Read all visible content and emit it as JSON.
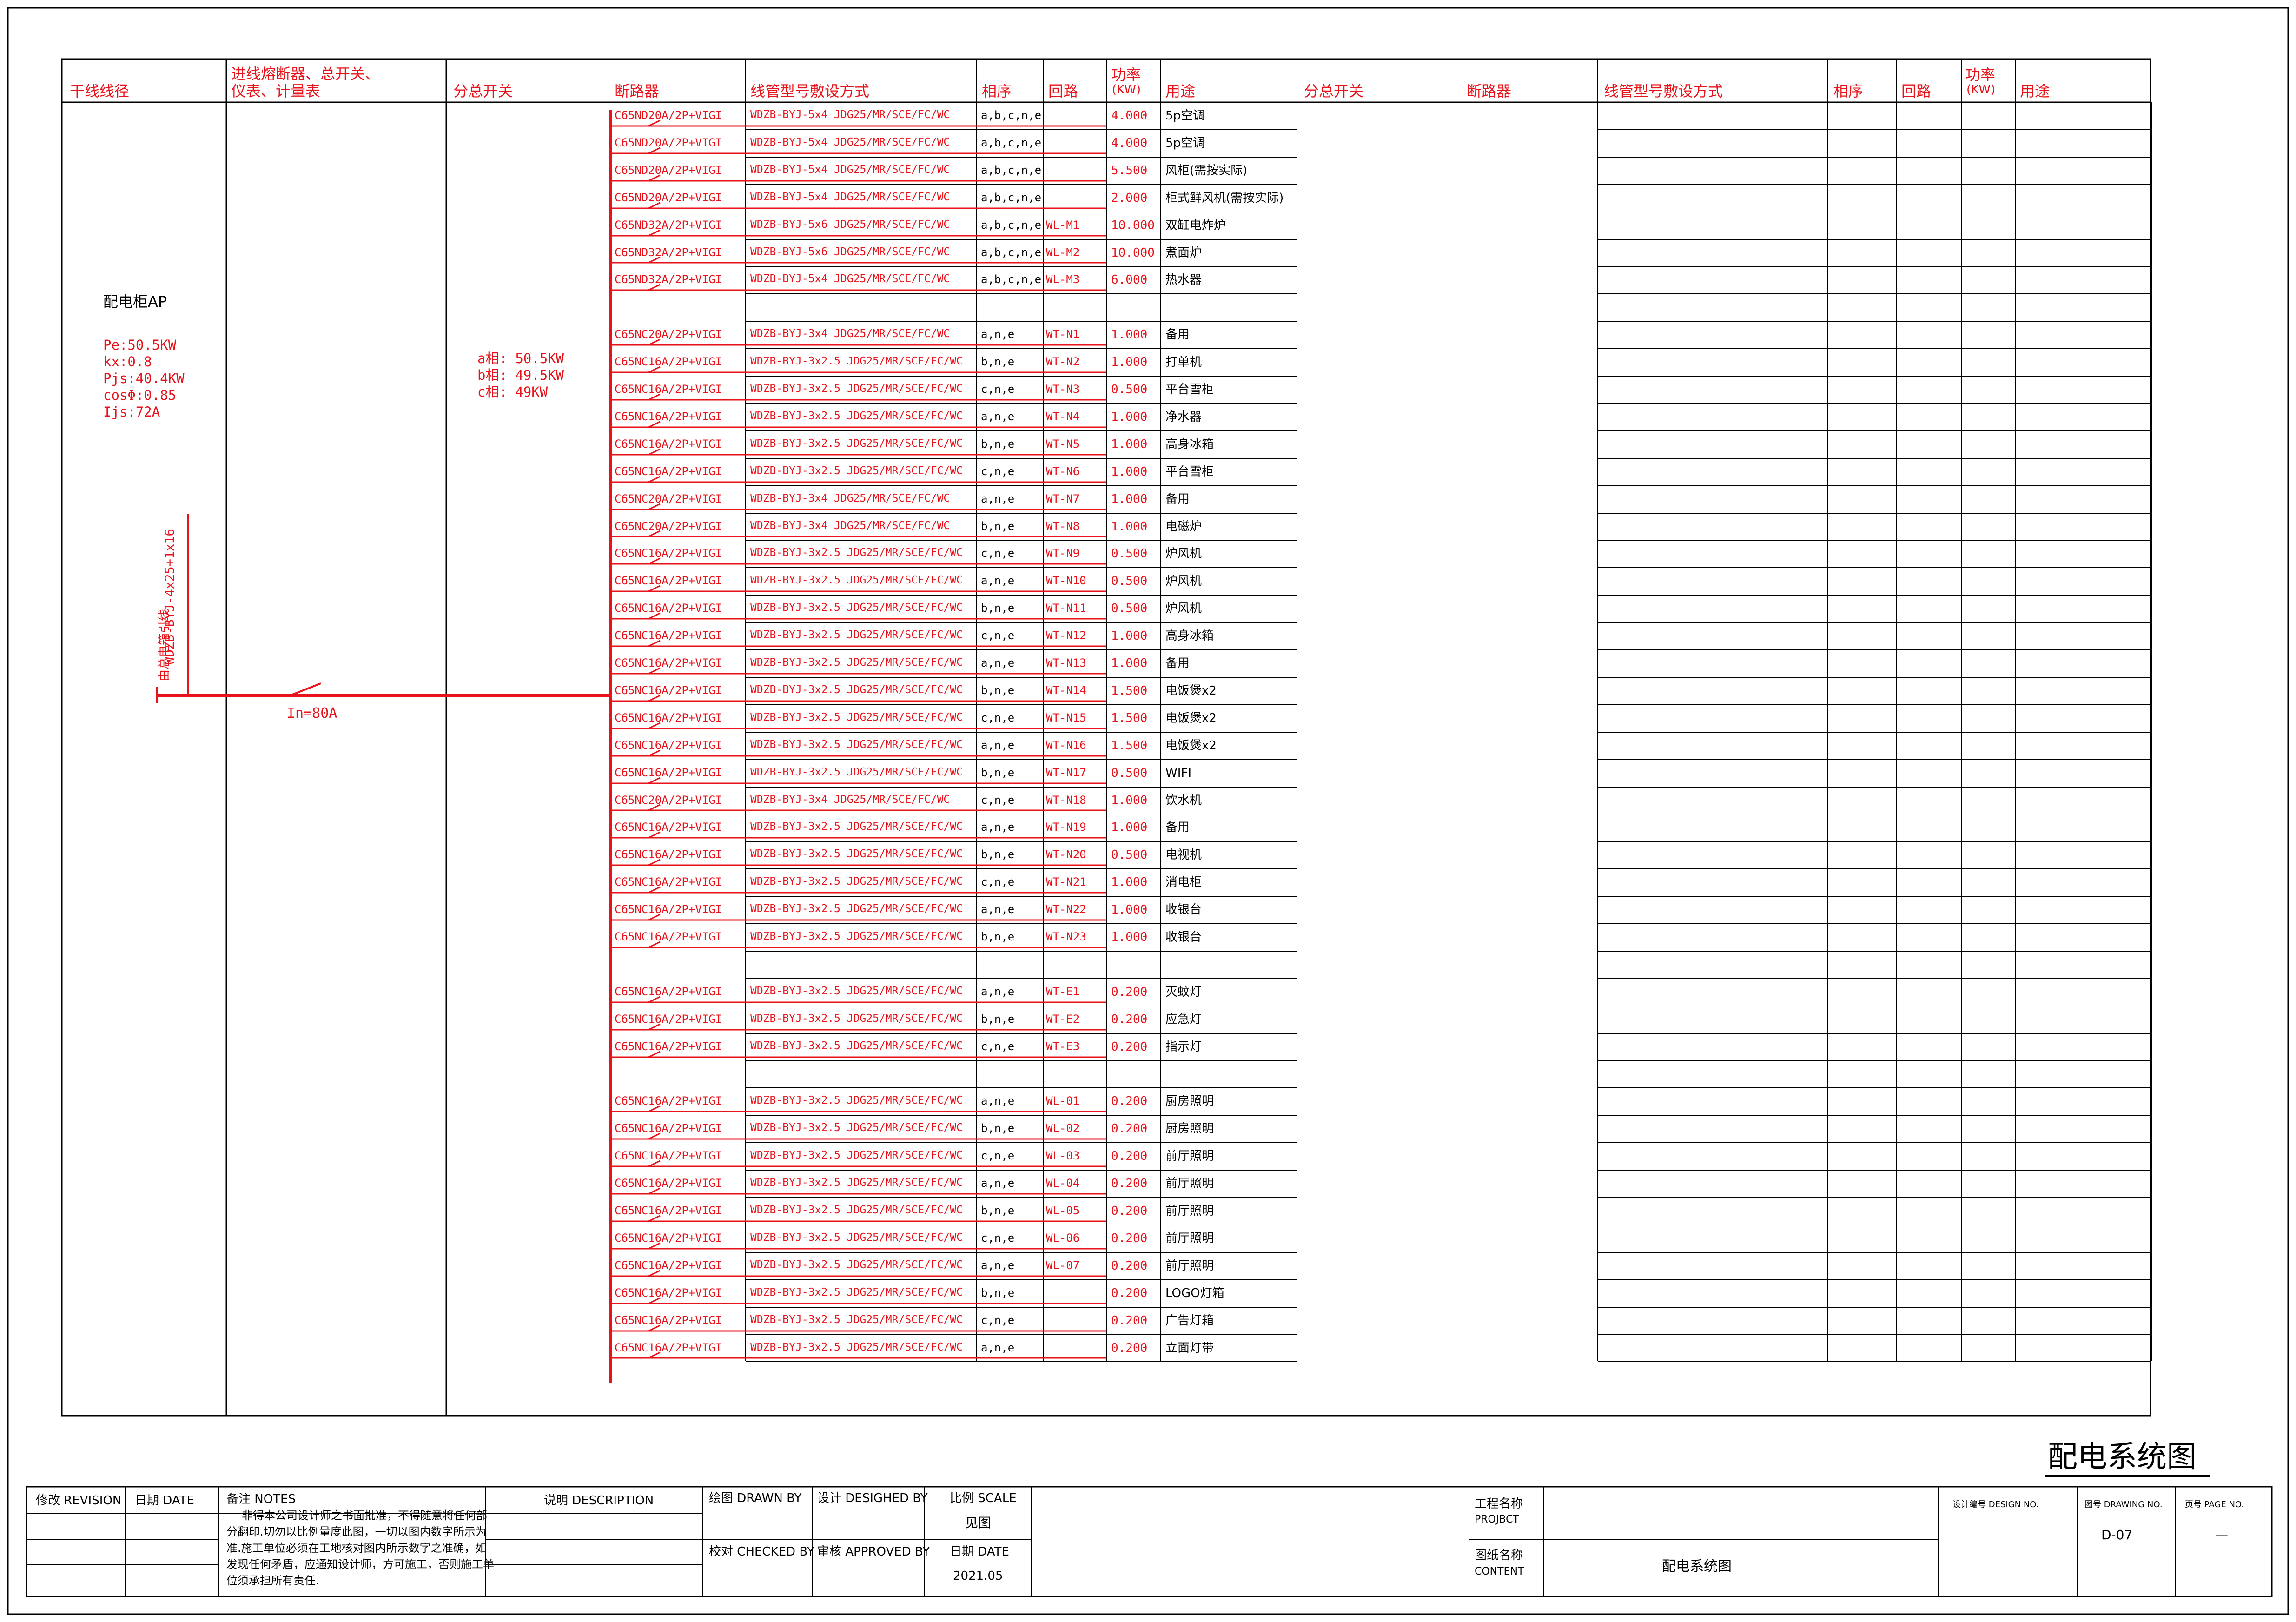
{
  "header": {
    "col_trunk": "干线线径",
    "col_incoming_line1": "进线熔断器、总开关、",
    "col_incoming_line2": "仪表、计量表",
    "col_sub_switch": "分总开关",
    "col_breaker": "断路器",
    "col_cable": "线管型号敷设方式",
    "col_phase": "相序",
    "col_circuit": "回路",
    "col_power_line1": "功率",
    "col_power_line2": "(KW)",
    "col_usage": "用途"
  },
  "panel": {
    "name": "配电柜AP",
    "pe": "Pe:50.5KW",
    "kx": "kx:0.8",
    "pjs": "Pjs:40.4KW",
    "cos": "cosΦ:0.85",
    "ijs": "Ijs:72A"
  },
  "phase_loads": {
    "a": "a相: 50.5KW",
    "b": "b相: 49.5KW",
    "c": "c相: 49KW"
  },
  "incoming": {
    "cable": "WDZB-BYJ-4x25+1x16",
    "source": "由总电箱引线",
    "breaker_rating": "In=80A"
  },
  "circuits": [
    {
      "breaker": "C65ND20A/2P+VIGI",
      "cable": "WDZB-BYJ-5x4  JDG25/MR/SCE/FC/WC",
      "phase": "a,b,c,n,e",
      "circuit": "",
      "power": "4.000",
      "usage": "5p空调"
    },
    {
      "breaker": "C65ND20A/2P+VIGI",
      "cable": "WDZB-BYJ-5x4  JDG25/MR/SCE/FC/WC",
      "phase": "a,b,c,n,e",
      "circuit": "",
      "power": "4.000",
      "usage": "5p空调"
    },
    {
      "breaker": "C65ND20A/2P+VIGI",
      "cable": "WDZB-BYJ-5x4  JDG25/MR/SCE/FC/WC",
      "phase": "a,b,c,n,e",
      "circuit": "",
      "power": "5.500",
      "usage": "风柜(需按实际)"
    },
    {
      "breaker": "C65ND20A/2P+VIGI",
      "cable": "WDZB-BYJ-5x4  JDG25/MR/SCE/FC/WC",
      "phase": "a,b,c,n,e",
      "circuit": "",
      "power": "2.000",
      "usage": "柜式鲜风机(需按实际)"
    },
    {
      "breaker": "C65ND32A/2P+VIGI",
      "cable": "WDZB-BYJ-5x6  JDG25/MR/SCE/FC/WC",
      "phase": "a,b,c,n,e",
      "circuit": "WL-M1",
      "power": "10.000",
      "usage": "双缸电炸炉"
    },
    {
      "breaker": "C65ND32A/2P+VIGI",
      "cable": "WDZB-BYJ-5x6  JDG25/MR/SCE/FC/WC",
      "phase": "a,b,c,n,e",
      "circuit": "WL-M2",
      "power": "10.000",
      "usage": "煮面炉"
    },
    {
      "breaker": "C65ND32A/2P+VIGI",
      "cable": "WDZB-BYJ-5x4  JDG25/MR/SCE/FC/WC",
      "phase": "a,b,c,n,e",
      "circuit": "WL-M3",
      "power": "6.000",
      "usage": "热水器"
    },
    {
      "breaker": "",
      "cable": "",
      "phase": "",
      "circuit": "",
      "power": "",
      "usage": ""
    },
    {
      "breaker": "C65NC20A/2P+VIGI",
      "cable": "WDZB-BYJ-3x4  JDG25/MR/SCE/FC/WC",
      "phase": "a,n,e",
      "circuit": "WT-N1",
      "power": "1.000",
      "usage": "备用"
    },
    {
      "breaker": "C65NC16A/2P+VIGI",
      "cable": "WDZB-BYJ-3x2.5  JDG25/MR/SCE/FC/WC",
      "phase": "b,n,e",
      "circuit": "WT-N2",
      "power": "1.000",
      "usage": "打单机"
    },
    {
      "breaker": "C65NC16A/2P+VIGI",
      "cable": "WDZB-BYJ-3x2.5  JDG25/MR/SCE/FC/WC",
      "phase": "c,n,e",
      "circuit": "WT-N3",
      "power": "0.500",
      "usage": "平台雪柜"
    },
    {
      "breaker": "C65NC16A/2P+VIGI",
      "cable": "WDZB-BYJ-3x2.5  JDG25/MR/SCE/FC/WC",
      "phase": "a,n,e",
      "circuit": "WT-N4",
      "power": "1.000",
      "usage": "净水器"
    },
    {
      "breaker": "C65NC16A/2P+VIGI",
      "cable": "WDZB-BYJ-3x2.5  JDG25/MR/SCE/FC/WC",
      "phase": "b,n,e",
      "circuit": "WT-N5",
      "power": "1.000",
      "usage": "高身冰箱"
    },
    {
      "breaker": "C65NC16A/2P+VIGI",
      "cable": "WDZB-BYJ-3x2.5  JDG25/MR/SCE/FC/WC",
      "phase": "c,n,e",
      "circuit": "WT-N6",
      "power": "1.000",
      "usage": "平台雪柜"
    },
    {
      "breaker": "C65NC20A/2P+VIGI",
      "cable": "WDZB-BYJ-3x4  JDG25/MR/SCE/FC/WC",
      "phase": "a,n,e",
      "circuit": "WT-N7",
      "power": "1.000",
      "usage": "备用"
    },
    {
      "breaker": "C65NC20A/2P+VIGI",
      "cable": "WDZB-BYJ-3x4  JDG25/MR/SCE/FC/WC",
      "phase": "b,n,e",
      "circuit": "WT-N8",
      "power": "1.000",
      "usage": "电磁炉"
    },
    {
      "breaker": "C65NC16A/2P+VIGI",
      "cable": "WDZB-BYJ-3x2.5  JDG25/MR/SCE/FC/WC",
      "phase": "c,n,e",
      "circuit": "WT-N9",
      "power": "0.500",
      "usage": "炉风机"
    },
    {
      "breaker": "C65NC16A/2P+VIGI",
      "cable": "WDZB-BYJ-3x2.5  JDG25/MR/SCE/FC/WC",
      "phase": "a,n,e",
      "circuit": "WT-N10",
      "power": "0.500",
      "usage": "炉风机"
    },
    {
      "breaker": "C65NC16A/2P+VIGI",
      "cable": "WDZB-BYJ-3x2.5  JDG25/MR/SCE/FC/WC",
      "phase": "b,n,e",
      "circuit": "WT-N11",
      "power": "0.500",
      "usage": "炉风机"
    },
    {
      "breaker": "C65NC16A/2P+VIGI",
      "cable": "WDZB-BYJ-3x2.5  JDG25/MR/SCE/FC/WC",
      "phase": "c,n,e",
      "circuit": "WT-N12",
      "power": "1.000",
      "usage": "高身冰箱"
    },
    {
      "breaker": "C65NC16A/2P+VIGI",
      "cable": "WDZB-BYJ-3x2.5  JDG25/MR/SCE/FC/WC",
      "phase": "a,n,e",
      "circuit": "WT-N13",
      "power": "1.000",
      "usage": "备用"
    },
    {
      "breaker": "C65NC16A/2P+VIGI",
      "cable": "WDZB-BYJ-3x2.5  JDG25/MR/SCE/FC/WC",
      "phase": "b,n,e",
      "circuit": "WT-N14",
      "power": "1.500",
      "usage": "电饭煲x2"
    },
    {
      "breaker": "C65NC16A/2P+VIGI",
      "cable": "WDZB-BYJ-3x2.5  JDG25/MR/SCE/FC/WC",
      "phase": "c,n,e",
      "circuit": "WT-N15",
      "power": "1.500",
      "usage": "电饭煲x2"
    },
    {
      "breaker": "C65NC16A/2P+VIGI",
      "cable": "WDZB-BYJ-3x2.5  JDG25/MR/SCE/FC/WC",
      "phase": "a,n,e",
      "circuit": "WT-N16",
      "power": "1.500",
      "usage": "电饭煲x2"
    },
    {
      "breaker": "C65NC16A/2P+VIGI",
      "cable": "WDZB-BYJ-3x2.5  JDG25/MR/SCE/FC/WC",
      "phase": "b,n,e",
      "circuit": "WT-N17",
      "power": "0.500",
      "usage": "WIFI"
    },
    {
      "breaker": "C65NC20A/2P+VIGI",
      "cable": "WDZB-BYJ-3x4  JDG25/MR/SCE/FC/WC",
      "phase": "c,n,e",
      "circuit": "WT-N18",
      "power": "1.000",
      "usage": "饮水机"
    },
    {
      "breaker": "C65NC16A/2P+VIGI",
      "cable": "WDZB-BYJ-3x2.5  JDG25/MR/SCE/FC/WC",
      "phase": "a,n,e",
      "circuit": "WT-N19",
      "power": "1.000",
      "usage": "备用"
    },
    {
      "breaker": "C65NC16A/2P+VIGI",
      "cable": "WDZB-BYJ-3x2.5  JDG25/MR/SCE/FC/WC",
      "phase": "b,n,e",
      "circuit": "WT-N20",
      "power": "0.500",
      "usage": "电视机"
    },
    {
      "breaker": "C65NC16A/2P+VIGI",
      "cable": "WDZB-BYJ-3x2.5  JDG25/MR/SCE/FC/WC",
      "phase": "c,n,e",
      "circuit": "WT-N21",
      "power": "1.000",
      "usage": "消电柜"
    },
    {
      "breaker": "C65NC16A/2P+VIGI",
      "cable": "WDZB-BYJ-3x2.5  JDG25/MR/SCE/FC/WC",
      "phase": "a,n,e",
      "circuit": "WT-N22",
      "power": "1.000",
      "usage": "收银台"
    },
    {
      "breaker": "C65NC16A/2P+VIGI",
      "cable": "WDZB-BYJ-3x2.5  JDG25/MR/SCE/FC/WC",
      "phase": "b,n,e",
      "circuit": "WT-N23",
      "power": "1.000",
      "usage": "收银台"
    },
    {
      "breaker": "",
      "cable": "",
      "phase": "",
      "circuit": "",
      "power": "",
      "usage": ""
    },
    {
      "breaker": "C65NC16A/2P+VIGI",
      "cable": "WDZB-BYJ-3x2.5  JDG25/MR/SCE/FC/WC",
      "phase": "a,n,e",
      "circuit": "WT-E1",
      "power": "0.200",
      "usage": "灭蚊灯"
    },
    {
      "breaker": "C65NC16A/2P+VIGI",
      "cable": "WDZB-BYJ-3x2.5  JDG25/MR/SCE/FC/WC",
      "phase": "b,n,e",
      "circuit": "WT-E2",
      "power": "0.200",
      "usage": "应急灯"
    },
    {
      "breaker": "C65NC16A/2P+VIGI",
      "cable": "WDZB-BYJ-3x2.5  JDG25/MR/SCE/FC/WC",
      "phase": "c,n,e",
      "circuit": "WT-E3",
      "power": "0.200",
      "usage": "指示灯"
    },
    {
      "breaker": "",
      "cable": "",
      "phase": "",
      "circuit": "",
      "power": "",
      "usage": ""
    },
    {
      "breaker": "C65NC16A/2P+VIGI",
      "cable": "WDZB-BYJ-3x2.5  JDG25/MR/SCE/FC/WC",
      "phase": "a,n,e",
      "circuit": "WL-01",
      "power": "0.200",
      "usage": "厨房照明"
    },
    {
      "breaker": "C65NC16A/2P+VIGI",
      "cable": "WDZB-BYJ-3x2.5  JDG25/MR/SCE/FC/WC",
      "phase": "b,n,e",
      "circuit": "WL-02",
      "power": "0.200",
      "usage": "厨房照明"
    },
    {
      "breaker": "C65NC16A/2P+VIGI",
      "cable": "WDZB-BYJ-3x2.5  JDG25/MR/SCE/FC/WC",
      "phase": "c,n,e",
      "circuit": "WL-03",
      "power": "0.200",
      "usage": "前厅照明"
    },
    {
      "breaker": "C65NC16A/2P+VIGI",
      "cable": "WDZB-BYJ-3x2.5  JDG25/MR/SCE/FC/WC",
      "phase": "a,n,e",
      "circuit": "WL-04",
      "power": "0.200",
      "usage": "前厅照明"
    },
    {
      "breaker": "C65NC16A/2P+VIGI",
      "cable": "WDZB-BYJ-3x2.5  JDG25/MR/SCE/FC/WC",
      "phase": "b,n,e",
      "circuit": "WL-05",
      "power": "0.200",
      "usage": "前厅照明"
    },
    {
      "breaker": "C65NC16A/2P+VIGI",
      "cable": "WDZB-BYJ-3x2.5  JDG25/MR/SCE/FC/WC",
      "phase": "c,n,e",
      "circuit": "WL-06",
      "power": "0.200",
      "usage": "前厅照明"
    },
    {
      "breaker": "C65NC16A/2P+VIGI",
      "cable": "WDZB-BYJ-3x2.5  JDG25/MR/SCE/FC/WC",
      "phase": "a,n,e",
      "circuit": "WL-07",
      "power": "0.200",
      "usage": "前厅照明"
    },
    {
      "breaker": "C65NC16A/2P+VIGI",
      "cable": "WDZB-BYJ-3x2.5  JDG25/MR/SCE/FC/WC",
      "phase": "b,n,e",
      "circuit": "",
      "power": "0.200",
      "usage": "LOGO灯箱"
    },
    {
      "breaker": "C65NC16A/2P+VIGI",
      "cable": "WDZB-BYJ-3x2.5  JDG25/MR/SCE/FC/WC",
      "phase": "c,n,e",
      "circuit": "",
      "power": "0.200",
      "usage": "广告灯箱"
    },
    {
      "breaker": "C65NC16A/2P+VIGI",
      "cable": "WDZB-BYJ-3x2.5  JDG25/MR/SCE/FC/WC",
      "phase": "a,n,e",
      "circuit": "",
      "power": "0.200",
      "usage": "立面灯带"
    }
  ],
  "drawing_title": "配电系统图",
  "titleblock": {
    "revision": "修改 REVISION",
    "date": "日期 DATE",
    "notes_label": "备注 NOTES",
    "notes_line1": "非得本公司设计师之书面批准，不得随意将任何部",
    "notes_line2": "分翻印.切勿以比例量度此图，一切以图内数字所示为",
    "notes_line3": "准.施工单位必须在工地核对图内所示数字之准确，如",
    "notes_line4": "发现任何矛盾，应通知设计师，方可施工，否则施工单",
    "notes_line5": "位须承担所有责任.",
    "description": "说明 DESCRIPTION",
    "drawn_by": "绘图 DRAWN BY",
    "designed_by": "设计 DESIGHED BY",
    "scale_label": "比例 SCALE",
    "scale_value": "见图",
    "checked_by": "校对 CHECKED BY",
    "approved_by": "审核 APPROVED BY",
    "date_label": "日期 DATE",
    "date_value": "2021.05",
    "project_label_cn": "工程名称",
    "project_label_en": "PROJBCT",
    "content_label_cn": "图纸名称",
    "content_label_en": "CONTENT",
    "content_value": "配电系统图",
    "design_no_label": "设计编号 DESIGN NO.",
    "drawing_no_label": "图号 DRAWING NO.",
    "drawing_no_value": "D-07",
    "page_no_label": "页号 PAGE NO.",
    "page_no_value": "—"
  },
  "colors": {
    "line": "#000000",
    "circuit": "#e8131a"
  }
}
